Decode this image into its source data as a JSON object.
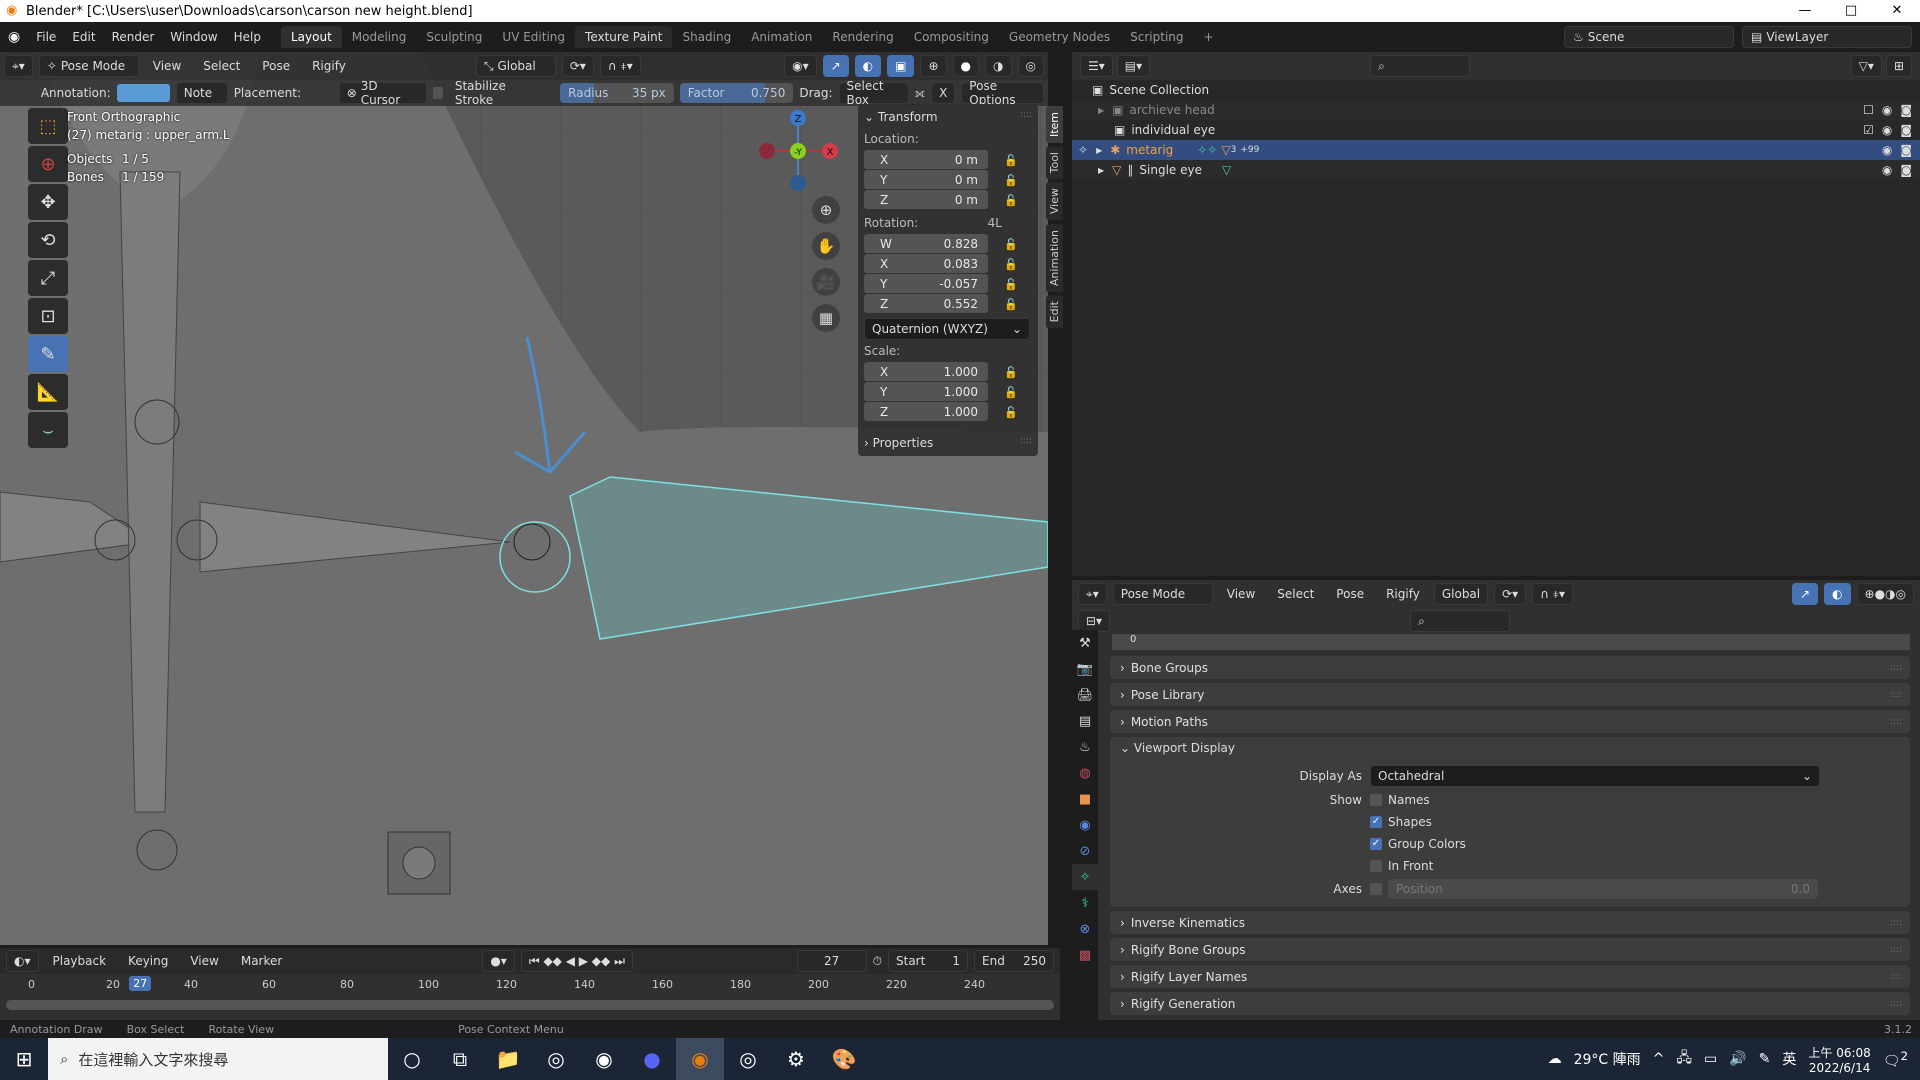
{
  "window": {
    "title": "Blender* [C:\\Users\\user\\Downloads\\carson\\carson new height.blend]",
    "controls": [
      "—",
      "□",
      "✕"
    ]
  },
  "menus": [
    "File",
    "Edit",
    "Render",
    "Window",
    "Help"
  ],
  "workspaces": [
    {
      "label": "Layout",
      "active": true
    },
    {
      "label": "Modeling"
    },
    {
      "label": "Sculpting"
    },
    {
      "label": "UV Editing"
    },
    {
      "label": "Texture Paint"
    },
    {
      "label": "Shading"
    },
    {
      "label": "Animation"
    },
    {
      "label": "Rendering"
    },
    {
      "label": "Compositing"
    },
    {
      "label": "Geometry Nodes"
    },
    {
      "label": "Scripting"
    }
  ],
  "add_workspace": "+",
  "scene": {
    "name": "Scene",
    "view_layer": "ViewLayer"
  },
  "viewport": {
    "mode": "Pose Mode",
    "menus": [
      "View",
      "Select",
      "Pose",
      "Rigify"
    ],
    "orientation": "Global",
    "annotation_label": "Annotation:",
    "annotation_color": "#5b9bd5",
    "annotation_layer": "Note",
    "placement_label": "Placement:",
    "placement_value": "3D Cursor",
    "stabilize_label": "Stabilize Stroke",
    "radius_label": "Radius",
    "radius_value": "35 px",
    "factor_label": "Factor",
    "factor_value": "0.750",
    "factor_fraction": 0.75,
    "drag_label": "Drag:",
    "drag_value": "Select Box",
    "pose_options": "Pose Options",
    "view_name": "Front Orthographic",
    "active_info": "(27) metarig : upper_arm.L",
    "objects_label": "Objects",
    "objects_value": "1 / 5",
    "bones_label": "Bones",
    "bones_value": "1 / 159",
    "gizmo": {
      "z": "Z",
      "y": "-Y",
      "x": "X"
    }
  },
  "npanel": {
    "transform_title": "Transform",
    "location_label": "Location:",
    "location": [
      {
        "axis": "X",
        "value": "0 m"
      },
      {
        "axis": "Y",
        "value": "0 m"
      },
      {
        "axis": "Z",
        "value": "0 m"
      }
    ],
    "rotation_label": "Rotation:",
    "rotation_mode_short": "4L",
    "rotation": [
      {
        "axis": "W",
        "value": "0.828"
      },
      {
        "axis": "X",
        "value": "0.083"
      },
      {
        "axis": "Y",
        "value": "-0.057"
      },
      {
        "axis": "Z",
        "value": "0.552"
      }
    ],
    "rotation_mode": "Quaternion (WXYZ)",
    "scale_label": "Scale:",
    "scale": [
      {
        "axis": "X",
        "value": "1.000"
      },
      {
        "axis": "Y",
        "value": "1.000"
      },
      {
        "axis": "Z",
        "value": "1.000"
      }
    ],
    "properties_title": "Properties",
    "tabs": [
      "Item",
      "Tool",
      "View",
      "Animation",
      "Edit"
    ]
  },
  "outliner": {
    "root": "Scene Collection",
    "items": [
      {
        "name": "archieve head",
        "excluded": true
      },
      {
        "name": "individual eye",
        "checked": true
      },
      {
        "name": "metarig",
        "selected": true,
        "badge": "+99",
        "sub_count": "3"
      },
      {
        "name": "Single eye"
      }
    ]
  },
  "props": {
    "mode": "Pose Mode",
    "menus": [
      "View",
      "Select",
      "Pose",
      "Rigify"
    ],
    "orientation": "Global",
    "layer_first": "0",
    "sections": [
      "Bone Groups",
      "Pose Library",
      "Motion Paths"
    ],
    "viewport_display": {
      "title": "Viewport Display",
      "display_as_label": "Display As",
      "display_as": "Octahedral",
      "show_label": "Show",
      "show": [
        {
          "label": "Names",
          "checked": false
        },
        {
          "label": "Shapes",
          "checked": true
        },
        {
          "label": "Group Colors",
          "checked": true
        },
        {
          "label": "In Front",
          "checked": false
        }
      ],
      "axes_label": "Axes",
      "axes_position_label": "Position",
      "axes_position_value": "0.0"
    },
    "sections_after": [
      "Inverse Kinematics",
      "Rigify Bone Groups",
      "Rigify Layer Names",
      "Rigify Generation"
    ]
  },
  "timeline": {
    "menus": [
      "Playback",
      "Keying",
      "View",
      "Marker"
    ],
    "current_frame": "27",
    "start_label": "Start",
    "start": "1",
    "end_label": "End",
    "end": "250",
    "ticks": [
      "0",
      "20",
      "40",
      "60",
      "80",
      "100",
      "120",
      "140",
      "160",
      "180",
      "200",
      "220",
      "240"
    ]
  },
  "status": {
    "items": [
      "Annotation Draw",
      "Box Select",
      "Rotate View",
      "Pose Context Menu"
    ],
    "version": "3.1.2"
  },
  "taskbar": {
    "search_placeholder": "在這裡輸入文字來搜尋",
    "weather": "29°C 陣雨",
    "ime": "英",
    "time": "上午 06:08",
    "date": "2022/6/14",
    "notifications": "2"
  }
}
